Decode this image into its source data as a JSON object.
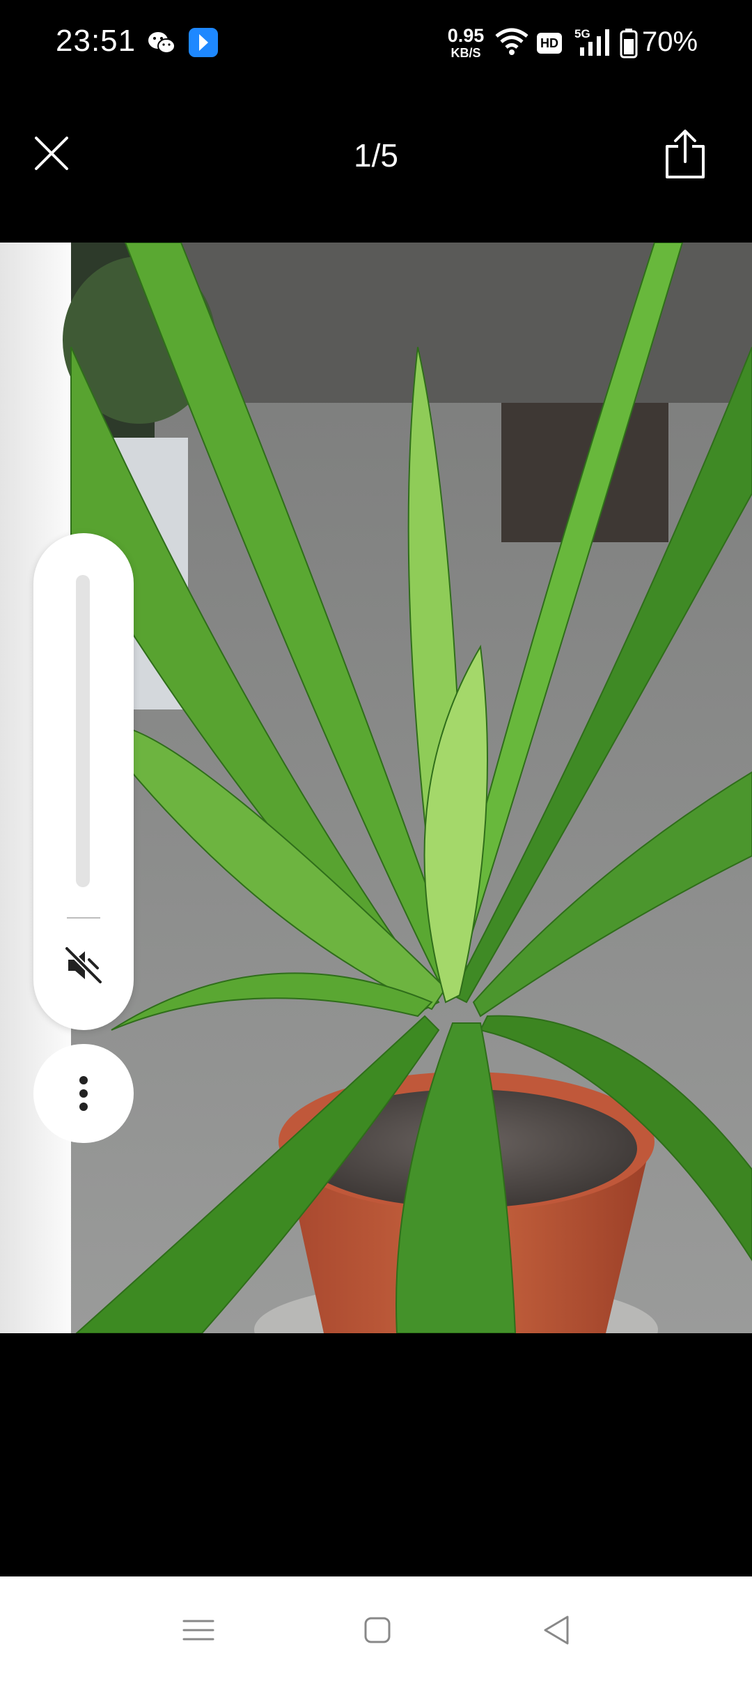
{
  "status_bar": {
    "time": "23:51",
    "net_speed_value": "0.95",
    "net_speed_unit": "KB/S",
    "hd_label": "HD",
    "network_label": "5G",
    "battery_percent": "70%",
    "icons": [
      "wechat-icon",
      "app-notification-icon",
      "wifi-icon",
      "hd-icon",
      "signal-icon",
      "battery-icon"
    ]
  },
  "viewer": {
    "counter": "1/5",
    "icons": [
      "close-icon",
      "share-icon"
    ]
  },
  "volume_panel": {
    "level": 0,
    "muted": true,
    "icons": [
      "speaker-muted-icon",
      "more-vertical-icon"
    ]
  },
  "nav_bar": {
    "icons": [
      "menu-icon",
      "home-icon",
      "back-icon"
    ]
  },
  "colors": {
    "background": "#000000",
    "panel": "#ffffff",
    "badge_blue": "#1e88ff"
  }
}
